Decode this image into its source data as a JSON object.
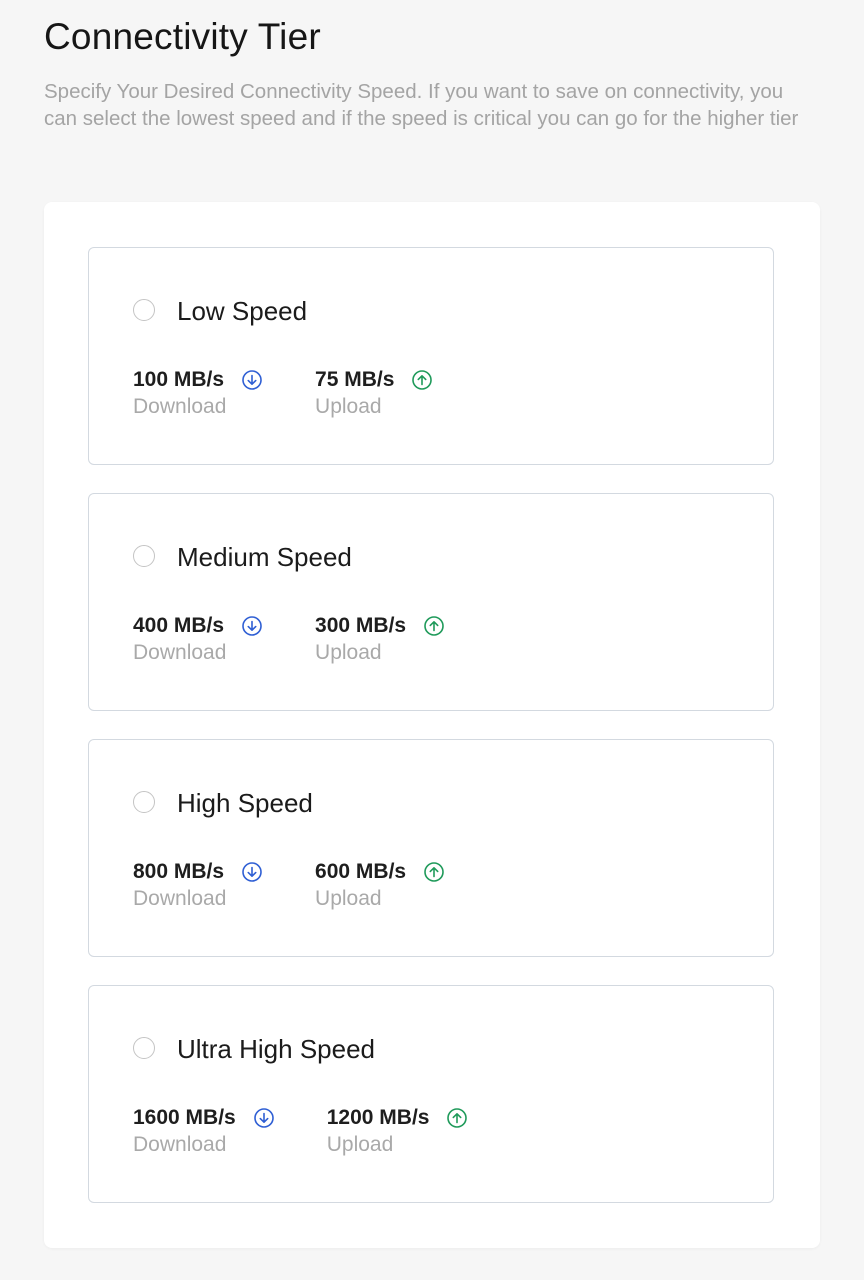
{
  "header": {
    "title": "Connectivity Tier",
    "description": "Specify Your Desired Connectivity Speed. If you want to save on connectivity, you can select the lowest speed and if the speed is critical you can go for the higher tier"
  },
  "colors": {
    "download_icon": "#2f5fd4",
    "upload_icon": "#1f9a5a",
    "card_border": "#d3d9e0"
  },
  "tiers": [
    {
      "name": "Low Speed",
      "selected": false,
      "download": {
        "value": "100 MB/s",
        "label": "Download",
        "icon": "arrow-down-circle-icon"
      },
      "upload": {
        "value": "75 MB/s",
        "label": "Upload",
        "icon": "arrow-up-circle-icon"
      }
    },
    {
      "name": "Medium Speed",
      "selected": false,
      "download": {
        "value": "400 MB/s",
        "label": "Download",
        "icon": "arrow-down-circle-icon"
      },
      "upload": {
        "value": "300 MB/s",
        "label": "Upload",
        "icon": "arrow-up-circle-icon"
      }
    },
    {
      "name": "High Speed",
      "selected": false,
      "download": {
        "value": "800 MB/s",
        "label": "Download",
        "icon": "arrow-down-circle-icon"
      },
      "upload": {
        "value": "600 MB/s",
        "label": "Upload",
        "icon": "arrow-up-circle-icon"
      }
    },
    {
      "name": "Ultra High Speed",
      "selected": false,
      "download": {
        "value": "1600 MB/s",
        "label": "Download",
        "icon": "arrow-down-circle-icon"
      },
      "upload": {
        "value": "1200 MB/s",
        "label": "Upload",
        "icon": "arrow-up-circle-icon"
      }
    }
  ]
}
